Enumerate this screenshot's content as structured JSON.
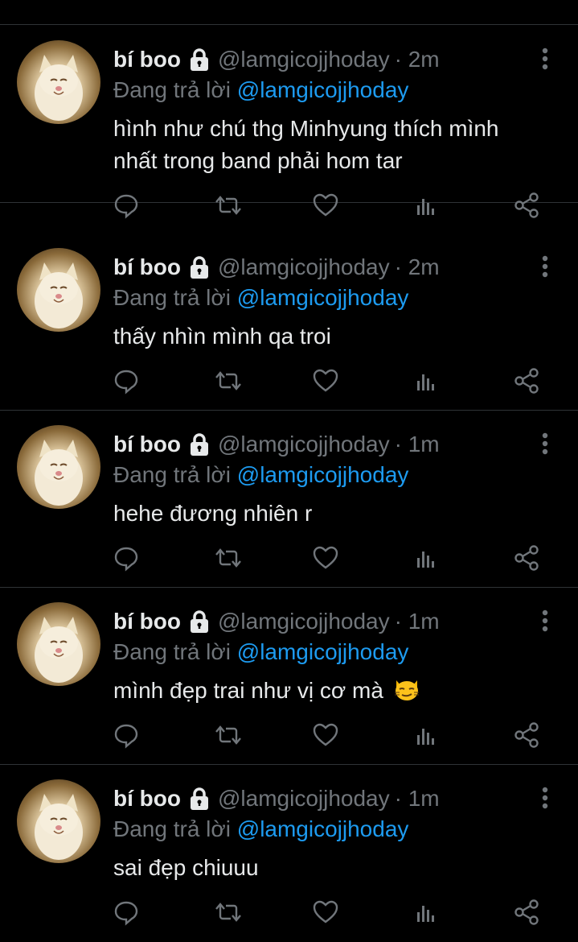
{
  "colors": {
    "background": "#000000",
    "divider": "#2f3336",
    "primary_text": "#e7e9ea",
    "secondary_text": "#71767b",
    "mention": "#1d9bf0"
  },
  "tweets": [
    {
      "name": "bí boo",
      "handle": "@lamgicojjhoday",
      "time": "· 2m",
      "reply_prefix": "Đang trả lời ",
      "reply_mention": "@lamgicojjhoday",
      "text_line1": "hình như chú thg Minhyung thích mình",
      "text_line2": "nhất trong band phải hom tar",
      "emoji": ""
    },
    {
      "name": "bí boo",
      "handle": "@lamgicojjhoday",
      "time": "· 2m",
      "reply_prefix": "Đang trả lời ",
      "reply_mention": "@lamgicojjhoday",
      "text_line1": "thấy nhìn mình qa troi",
      "text_line2": "",
      "emoji": ""
    },
    {
      "name": "bí boo",
      "handle": "@lamgicojjhoday",
      "time": "· 1m",
      "reply_prefix": "Đang trả lời ",
      "reply_mention": "@lamgicojjhoday",
      "text_line1": "hehe đương nhiên r",
      "text_line2": "",
      "emoji": ""
    },
    {
      "name": "bí boo",
      "handle": "@lamgicojjhoday",
      "time": "· 1m",
      "reply_prefix": "Đang trả lời ",
      "reply_mention": "@lamgicojjhoday",
      "text_line1": "mình đẹp trai như vị cơ mà",
      "text_line2": "",
      "emoji": "smirking-cat-emoji"
    },
    {
      "name": "bí boo",
      "handle": "@lamgicojjhoday",
      "time": "· 1m",
      "reply_prefix": "Đang trả lời ",
      "reply_mention": "@lamgicojjhoday",
      "text_line1": "sai đẹp chiuuu",
      "text_line2": "",
      "emoji": ""
    }
  ],
  "action_icons": [
    "reply-icon",
    "retweet-icon",
    "like-icon",
    "views-icon",
    "share-icon"
  ]
}
